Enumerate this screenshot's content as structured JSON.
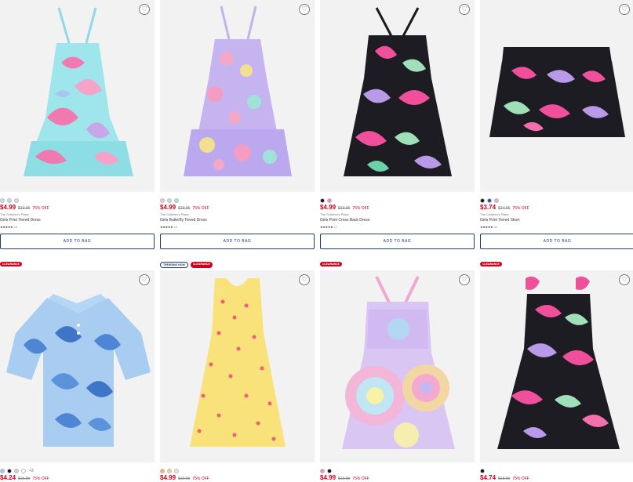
{
  "products": [
    {
      "swatches": [
        "#b9e7ee",
        "#c8d6f0",
        "#d8dce6"
      ],
      "price": "$4.99",
      "original_price": "$19.95",
      "discount": "75% OFF",
      "brand": "The Children's Place",
      "name": "Girls Print Tiered Dress",
      "stars": "★★★★★",
      "reviews": "16",
      "button": "ADD TO BAG",
      "badges": []
    },
    {
      "swatches": [
        "#e8c8e4",
        "#bde4df",
        "#a9e1dc"
      ],
      "price": "$4.99",
      "original_price": "$19.95",
      "discount": "75% OFF",
      "brand": "The Children's Place",
      "name": "Girls Butterfly Tiered Dress",
      "stars": "★★★★★",
      "reviews": "16",
      "button": "ADD TO BAG",
      "badges": []
    },
    {
      "swatches": [
        "#111111",
        "#f08dc2"
      ],
      "price": "$4.99",
      "original_price": "$19.95",
      "discount": "75% OFF",
      "brand": "The Children's Place",
      "name": "Girls Print Cross Back Dress",
      "stars": "★★★★★",
      "reviews": "17",
      "button": "ADD TO BAG",
      "badges": []
    },
    {
      "swatches": [
        "#111111",
        "#1f4fa6",
        "#c8b8e6"
      ],
      "price": "$3.74",
      "original_price": "$14.95",
      "discount": "75% OFF",
      "brand": "The Children's Place",
      "name": "Girls Print Tiered Skort",
      "stars": "★★★★★",
      "reviews": "22",
      "button": "ADD TO BAG",
      "badges": []
    },
    {
      "swatches": [
        "#9dc3ea",
        "#111111",
        "#c6d4e6",
        "#ffffff"
      ],
      "more_colors": "+3",
      "price": "$4.24",
      "original_price": "$16.95",
      "discount": "75% OFF",
      "badges": [
        {
          "label": "CLEARANCE",
          "style": "clearance"
        }
      ]
    },
    {
      "swatches": [
        "#f7b36b",
        "#f6d36a",
        "#e6e6e6"
      ],
      "price": "$4.99",
      "original_price": "$19.95",
      "discount": "75% OFF",
      "badges": [
        {
          "label": "TRENDING NOW",
          "style": "trending"
        },
        {
          "label": "CLEARANCE",
          "style": "clearance"
        }
      ]
    },
    {
      "swatches": [
        "#f08dc2",
        "#111111"
      ],
      "price": "$4.99",
      "original_price": "$19.95",
      "discount": "75% OFF",
      "badges": [
        {
          "label": "CLEARANCE",
          "style": "clearance"
        }
      ]
    },
    {
      "swatches": [
        "#111111"
      ],
      "price": "$4.74",
      "original_price": "$18.95",
      "discount": "75% OFF",
      "badges": [
        {
          "label": "CLEARANCE",
          "style": "clearance"
        }
      ]
    }
  ],
  "icons": {
    "wishlist": "heart-icon"
  }
}
